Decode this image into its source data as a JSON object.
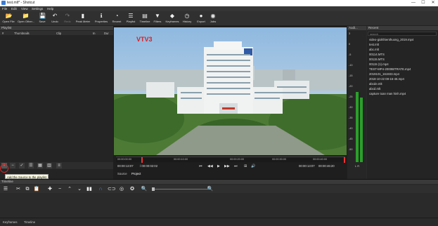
{
  "window": {
    "title": "test.mlt* - Shotcut",
    "controls": {
      "minimize": "—",
      "maximize": "☐",
      "close": "✕"
    }
  },
  "menu": [
    "File",
    "Edit",
    "View",
    "Settings",
    "Help"
  ],
  "toolbar": [
    {
      "label": "Open File",
      "icon": "folder-open-icon",
      "glyph": "📂"
    },
    {
      "label": "Open Other...",
      "icon": "folder-other-icon",
      "glyph": "📁"
    },
    {
      "label": "Save",
      "icon": "save-icon",
      "glyph": "💾"
    },
    {
      "label": "Undo",
      "icon": "undo-icon",
      "glyph": "↶"
    },
    {
      "label": "Redo",
      "icon": "redo-icon",
      "glyph": "↷"
    },
    {
      "label": "Peak Meter",
      "icon": "peak-meter-icon",
      "glyph": "▮"
    },
    {
      "label": "Properties",
      "icon": "info-icon",
      "glyph": "ℹ"
    },
    {
      "label": "Recent",
      "icon": "clock-icon",
      "glyph": "◔"
    },
    {
      "label": "Playlist",
      "icon": "list-icon",
      "glyph": "☰"
    },
    {
      "label": "Timeline",
      "icon": "timeline-icon",
      "glyph": "▤"
    },
    {
      "label": "Filters",
      "icon": "filter-icon",
      "glyph": "▼"
    },
    {
      "label": "Keyframes",
      "icon": "keyframes-icon",
      "glyph": "◆"
    },
    {
      "label": "History",
      "icon": "history-icon",
      "glyph": "◷"
    },
    {
      "label": "Export",
      "icon": "export-icon",
      "glyph": "●"
    },
    {
      "label": "Jobs",
      "icon": "jobs-icon",
      "glyph": "◉"
    }
  ],
  "playlist": {
    "title": "Playlist",
    "columns": [
      "#",
      "Thumbnails",
      "Clip",
      "In",
      "Dur"
    ],
    "tooltip": "Add the Source to the playlist"
  },
  "viewer": {
    "ruler_ticks": [
      "00:00:00:00",
      "00:00:10:00",
      "00:00:20:00",
      "00:00:30:00",
      "00:00:40:00"
    ],
    "current_time": "00:00:13:07",
    "in_point": "/ 00:00:02:02",
    "out_point": "00:00:13:07",
    "duration": "00:00:46:20",
    "tabs": [
      "Source",
      "Project"
    ],
    "logo": "VTV3"
  },
  "audio": {
    "title": "Audi...",
    "scale": [
      "3",
      "0",
      "-5",
      "-10",
      "-15",
      "-20",
      "-25",
      "-30",
      "-35",
      "-40",
      "-45",
      "-50"
    ],
    "channels": "L R"
  },
  "recent": {
    "title": "Recent",
    "search_placeholder": "search",
    "items": [
      "video-giolithienthuong_2019.mp4",
      "test.mlt",
      "abc.mlt",
      "00114.MTS",
      "00115.MTS",
      "00115 (1).mp4",
      "TEST-MP4-2000BITRATE.mp4",
      "2019101_161933.mp4",
      "2018-10-22 08-16-46.mp4",
      "abcde.mlt",
      "abcd.mlt",
      "capture toan man hinh.mp4"
    ]
  },
  "timeline": {
    "title": "Timeline"
  },
  "statusbar": {
    "tabs": [
      "Keyframes",
      "Timeline"
    ]
  }
}
